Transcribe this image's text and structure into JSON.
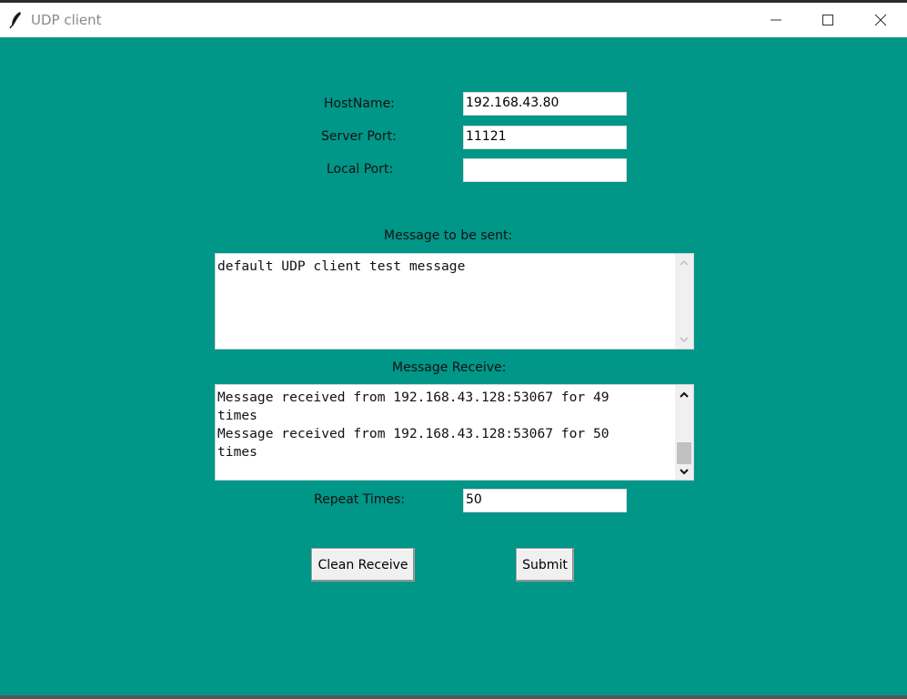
{
  "window": {
    "title": "UDP client",
    "app_icon": "feather-icon"
  },
  "titlebar_buttons": [
    "minimize-icon",
    "maximize-icon",
    "close-icon"
  ],
  "form": {
    "hostname_label": "HostName:",
    "hostname_value": "192.168.43.80",
    "server_port_label": "Server Port:",
    "server_port_value": "11121",
    "local_port_label": "Local Port:",
    "local_port_value": ""
  },
  "send": {
    "label": "Message to be sent:",
    "text": "default UDP client test message"
  },
  "receive": {
    "label": "Message Receive:",
    "text": "Message received from 192.168.43.128:53067 for 49\ntimes\nMessage received from 192.168.43.128:53067 for 50\ntimes"
  },
  "repeat": {
    "label": "Repeat Times:",
    "value": "50"
  },
  "buttons": {
    "clean_label": "Clean Receive",
    "submit_label": "Submit"
  },
  "colors": {
    "background": "#009688",
    "entry_bg": "#ffffff",
    "button_bg": "#f0f0f0"
  }
}
